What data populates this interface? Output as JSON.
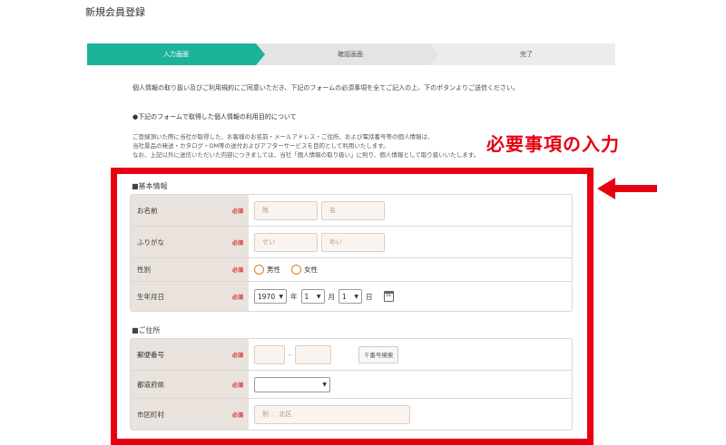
{
  "page": {
    "title": "新規会員登録"
  },
  "steps": [
    {
      "label": "入力画面",
      "active": true
    },
    {
      "label": "確認画面",
      "active": false
    },
    {
      "label": "完了",
      "active": false
    }
  ],
  "intro": "個人情報の取り扱い及びご利用規約にご同意いただき、下記のフォームの必須事項を全てご記入の上、下のボタンよりご送信ください。",
  "purpose": {
    "heading": "●下記のフォームで取得した個人情報の利用目的について",
    "lines": [
      "ご登録頂いた際に当社が取得した、お客様のお名前・メールアドレス・ご住所、および電話番号等の個人情報は、",
      "当社景品の発送・カタログ・DM等の送付およびアフターサービスを目的として利用いたします。",
      "なお、上記以外に送信いただいた内容につきましては、当社「個人情報の取り扱い」に則り、個人情報として取り扱いいたします。"
    ]
  },
  "annotation": {
    "callout": "必要事項の入力",
    "color": "#e60012"
  },
  "required_badge": "必須",
  "basic": {
    "title": "■基本情報",
    "name_label": "お名前",
    "name_last_placeholder": "姓",
    "name_first_placeholder": "名",
    "kana_label": "ふりがな",
    "kana_last_placeholder": "せい",
    "kana_first_placeholder": "めい",
    "gender_label": "性別",
    "gender_male": "男性",
    "gender_female": "女性",
    "birth_label": "生年月日",
    "birth_year": "1970",
    "year_unit": "年",
    "birth_month": "1",
    "month_unit": "月",
    "birth_day": "1",
    "day_unit": "日",
    "calendar_text": "31"
  },
  "address": {
    "title": "■ご住所",
    "zip_label": "郵便番号",
    "zip_dash": "-",
    "zip_search": "〒番号検索",
    "pref_label": "都道府県",
    "pref_value": "",
    "city_label": "市区町村",
    "city_placeholder": "例 ： 北区"
  },
  "colors": {
    "accent": "#1bb39a",
    "label_bg": "#eae3dd",
    "required": "#d32f2f",
    "input_bg": "#fbf4ee",
    "radio": "#d9822b"
  }
}
